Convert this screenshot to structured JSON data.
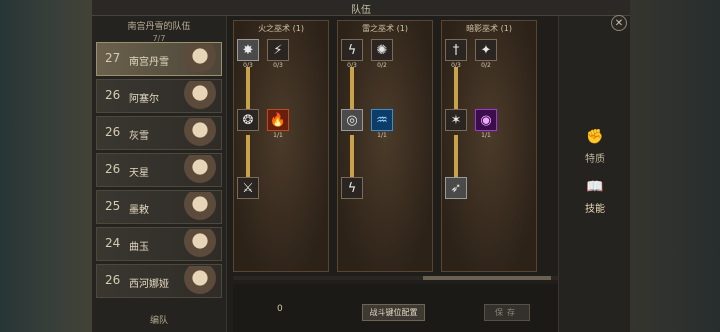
{
  "window": {
    "title": "队伍"
  },
  "roster": {
    "title": "南宫丹雪的队伍",
    "count": "7/7",
    "footer": "编队",
    "members": [
      {
        "level": "27",
        "name": "南宫丹雪",
        "selected": true
      },
      {
        "level": "26",
        "name": "阿塞尔"
      },
      {
        "level": "26",
        "name": "灰雪"
      },
      {
        "level": "26",
        "name": "天星"
      },
      {
        "level": "25",
        "name": "墨敕"
      },
      {
        "level": "24",
        "name": "曲玉"
      },
      {
        "level": "26",
        "name": "西河娜娅"
      }
    ]
  },
  "skill_columns": [
    {
      "title": "火之巫术 (1)",
      "top_counts": [
        "0/3",
        "0/3"
      ],
      "mid_counts": [
        "1/1"
      ],
      "icons": [
        "burst-icon",
        "claw-icon",
        "swirl-icon",
        "fire-icon",
        "strike-icon"
      ]
    },
    {
      "title": "雷之巫术 (1)",
      "top_counts": [
        "0/3",
        "0/2"
      ],
      "mid_counts": [
        "1/1"
      ],
      "icons": [
        "lightning-icon",
        "vortex-icon",
        "spiral-icon",
        "water-icon",
        "bolt-icon"
      ]
    },
    {
      "title": "暗影巫术 (1)",
      "top_counts": [
        "0/3",
        "0/2"
      ],
      "mid_counts": [
        "1/1"
      ],
      "icons": [
        "sword-icon",
        "shard-icon",
        "shadow-icon",
        "void-icon",
        "wing-icon"
      ]
    }
  ],
  "bottom": {
    "points": "0",
    "config_button": "战斗键位配置",
    "save_button": "保存"
  },
  "sidetabs": [
    {
      "label": "特质",
      "icon": "fist-icon",
      "active": false
    },
    {
      "label": "技能",
      "icon": "book-icon",
      "active": true
    }
  ]
}
